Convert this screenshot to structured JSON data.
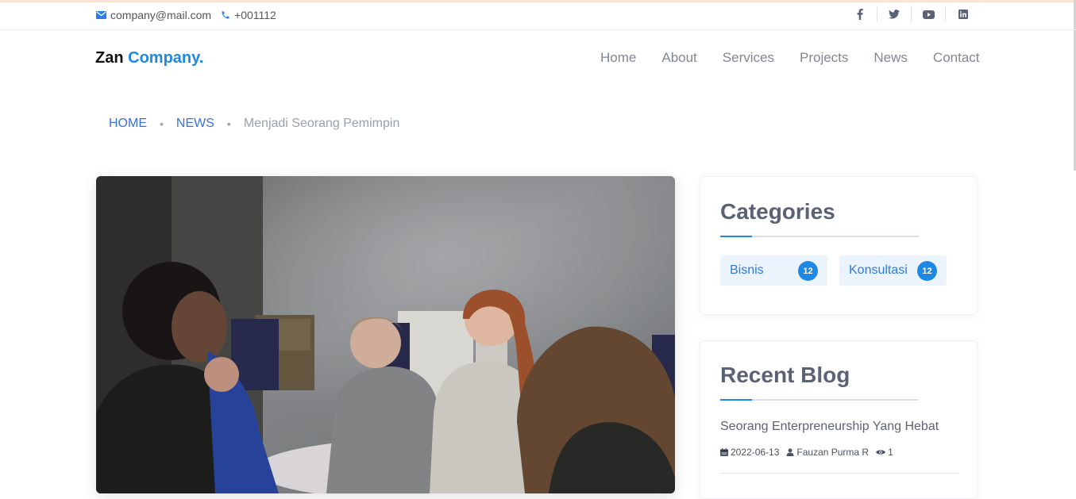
{
  "topbar": {
    "email": "company@mail.com",
    "phone": "+001112",
    "social": [
      {
        "name": "facebook-icon"
      },
      {
        "name": "twitter-icon"
      },
      {
        "name": "youtube-icon"
      },
      {
        "name": "linkedin-icon"
      }
    ]
  },
  "brand": {
    "part1": "Zan",
    "part2": "Company."
  },
  "menu": [
    "Home",
    "About",
    "Services",
    "Projects",
    "News",
    "Contact"
  ],
  "breadcrumb": {
    "home": "HOME",
    "news": "NEWS",
    "current": "Menjadi Seorang Pemimpin"
  },
  "hero": {
    "alt": "students discussing at a table"
  },
  "categories": {
    "title": "Categories",
    "items": [
      {
        "label": "Bisnis",
        "count": "12"
      },
      {
        "label": "Konsultasi",
        "count": "12"
      }
    ]
  },
  "recent_blog": {
    "title": "Recent Blog",
    "posts": [
      {
        "title": "Seorang Enterpreneurship Yang Hebat",
        "date": "2022-06-13",
        "author": "Fauzan Purma R",
        "views": "1"
      }
    ]
  },
  "colors": {
    "accent": "#1e88e5",
    "link": "#3a72d8",
    "muted": "#808693",
    "heading": "#5b6275"
  }
}
